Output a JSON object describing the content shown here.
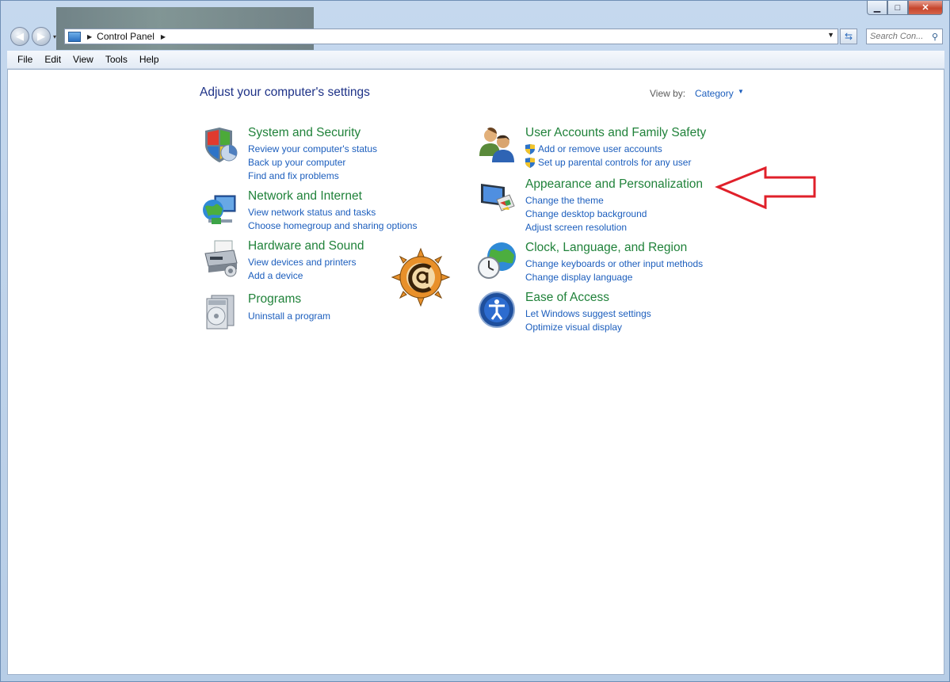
{
  "window": {
    "caption_min": "▁",
    "caption_max": "□",
    "caption_close": "✕"
  },
  "nav": {
    "back_glyph": "◀",
    "forward_glyph": "▶"
  },
  "address": {
    "breadcrumb": "Control Panel",
    "search_placeholder": "Search Con..."
  },
  "menu": [
    "File",
    "Edit",
    "View",
    "Tools",
    "Help"
  ],
  "page_title": "Adjust your computer's settings",
  "view_by": {
    "label": "View by:",
    "value": "Category"
  },
  "categories_left": [
    {
      "icon": "security-shield-icon",
      "title": "System and Security",
      "links": [
        "Review your computer's status",
        "Back up your computer",
        "Find and fix problems"
      ]
    },
    {
      "icon": "network-globe-icon",
      "title": "Network and Internet",
      "links": [
        "View network status and tasks",
        "Choose homegroup and sharing options"
      ]
    },
    {
      "icon": "printer-icon",
      "title": "Hardware and Sound",
      "links": [
        "View devices and printers",
        "Add a device"
      ]
    },
    {
      "icon": "programs-icon",
      "title": "Programs",
      "links": [
        "Uninstall a program"
      ]
    }
  ],
  "categories_right": [
    {
      "icon": "users-icon",
      "title": "User Accounts and Family Safety",
      "links": [
        "Add or remove user accounts",
        "Set up parental controls for any user"
      ]
    },
    {
      "icon": "display-paint-icon",
      "title": "Appearance and Personalization",
      "links": [
        "Change the theme",
        "Change desktop background",
        "Adjust screen resolution"
      ]
    },
    {
      "icon": "clock-globe-icon",
      "title": "Clock, Language, and Region",
      "links": [
        "Change keyboards or other input methods",
        "Change display language"
      ]
    },
    {
      "icon": "ease-of-access-icon",
      "title": "Ease of Access",
      "links": [
        "Let Windows suggest settings",
        "Optimize visual display"
      ]
    }
  ],
  "colors": {
    "category_title": "#20823a",
    "link": "#1c5ebd",
    "page_title": "#1e3287",
    "annotation_arrow": "#e0202a",
    "logo": "#e8902a"
  }
}
